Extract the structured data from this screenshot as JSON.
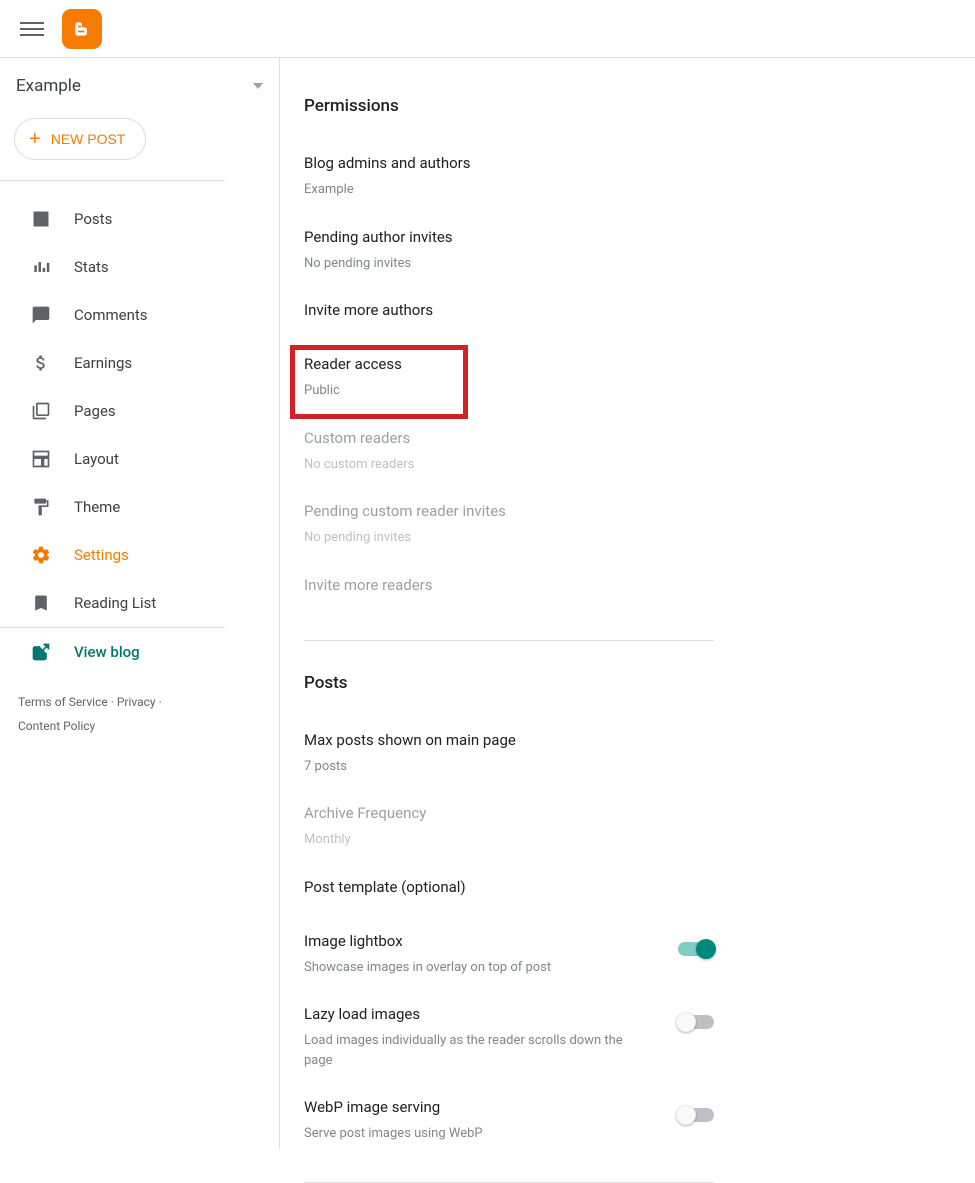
{
  "header": {
    "blog_name": "Example"
  },
  "new_post_label": "NEW POST",
  "nav": {
    "posts": "Posts",
    "stats": "Stats",
    "comments": "Comments",
    "earnings": "Earnings",
    "pages": "Pages",
    "layout": "Layout",
    "theme": "Theme",
    "settings": "Settings",
    "reading_list": "Reading List",
    "view_blog": "View blog"
  },
  "footer": {
    "tos": "Terms of Service",
    "privacy": "Privacy",
    "content_policy": "Content Policy"
  },
  "permissions": {
    "title": "Permissions",
    "admins_label": "Blog admins and authors",
    "admins_value": "Example",
    "pending_label": "Pending author invites",
    "pending_value": "No pending invites",
    "invite_authors": "Invite more authors",
    "reader_access_label": "Reader access",
    "reader_access_value": "Public",
    "custom_readers_label": "Custom readers",
    "custom_readers_value": "No custom readers",
    "pending_reader_label": "Pending custom reader invites",
    "pending_reader_value": "No pending invites",
    "invite_readers": "Invite more readers"
  },
  "posts": {
    "title": "Posts",
    "max_posts_label": "Max posts shown on main page",
    "max_posts_value": "7 posts",
    "archive_label": "Archive Frequency",
    "archive_value": "Monthly",
    "post_template_label": "Post template (optional)",
    "lightbox_label": "Image lightbox",
    "lightbox_desc": "Showcase images in overlay on top of post",
    "lazy_label": "Lazy load images",
    "lazy_desc": "Load images individually as the reader scrolls down the page",
    "webp_label": "WebP image serving",
    "webp_desc": "Serve post images using WebP"
  }
}
